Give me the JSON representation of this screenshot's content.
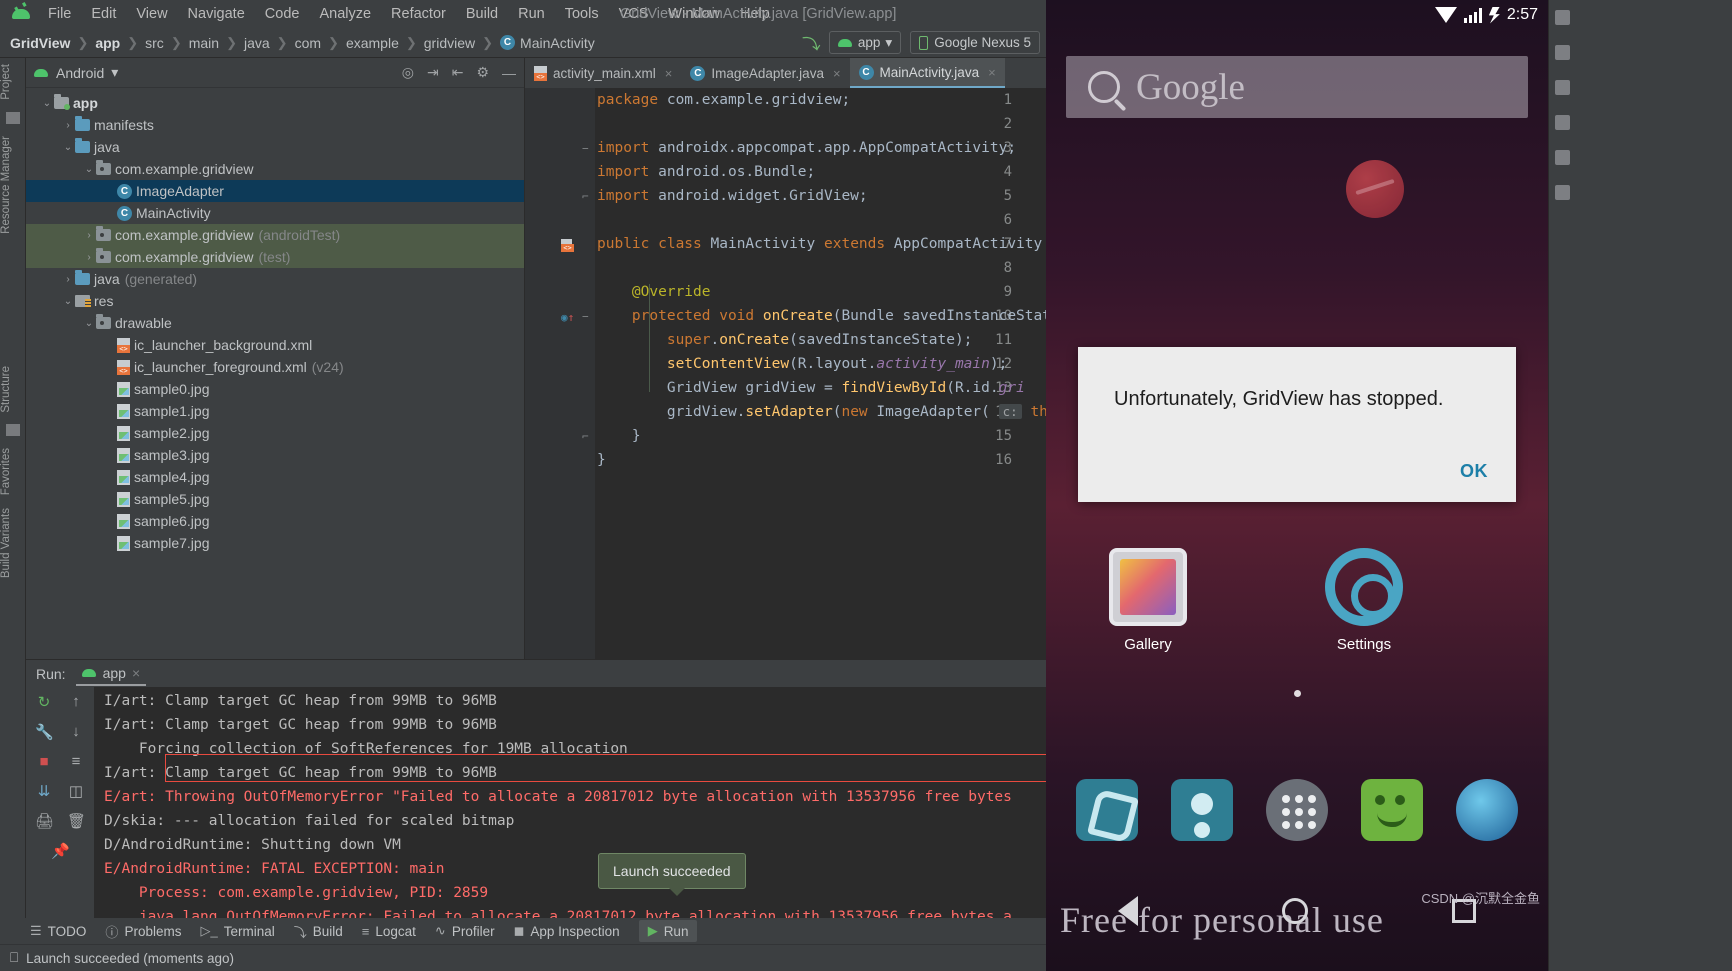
{
  "window": {
    "title": "GridView - MainActivity.java [GridView.app]"
  },
  "menu": {
    "items": [
      "File",
      "Edit",
      "View",
      "Navigate",
      "Code",
      "Analyze",
      "Refactor",
      "Build",
      "Run",
      "Tools",
      "VCS",
      "Window",
      "Help"
    ]
  },
  "breadcrumb": {
    "items": [
      "GridView",
      "app",
      "src",
      "main",
      "java",
      "com",
      "example",
      "gridview"
    ],
    "last": "MainActivity",
    "last_badge": "C"
  },
  "toolbar": {
    "hammer_icon": "build-hammer-icon",
    "run_config": "app",
    "device": "Google Nexus 5",
    "chevron": "▾"
  },
  "project": {
    "title": "Android",
    "chevron": "▾",
    "tools": [
      "locate-icon",
      "expand-all-icon",
      "collapse-all-icon",
      "settings-gear-icon",
      "hide-icon"
    ],
    "tree": [
      {
        "indent": 0,
        "arrow": "⌄",
        "icon": "folder-module",
        "label": "app",
        "dim": "",
        "bold": true,
        "state": ""
      },
      {
        "indent": 1,
        "arrow": "›",
        "icon": "folder",
        "label": "manifests",
        "dim": "",
        "bold": false,
        "state": ""
      },
      {
        "indent": 1,
        "arrow": "⌄",
        "icon": "folder",
        "label": "java",
        "dim": "",
        "bold": false,
        "state": ""
      },
      {
        "indent": 2,
        "arrow": "⌄",
        "icon": "package",
        "label": "com.example.gridview",
        "dim": "",
        "bold": false,
        "state": ""
      },
      {
        "indent": 3,
        "arrow": "",
        "icon": "class",
        "label": "ImageAdapter",
        "dim": "",
        "bold": false,
        "state": "selected"
      },
      {
        "indent": 3,
        "arrow": "",
        "icon": "class",
        "label": "MainActivity",
        "dim": "",
        "bold": false,
        "state": ""
      },
      {
        "indent": 2,
        "arrow": "›",
        "icon": "package",
        "label": "com.example.gridview",
        "dim": "(androidTest)",
        "bold": false,
        "state": "test"
      },
      {
        "indent": 2,
        "arrow": "›",
        "icon": "package",
        "label": "com.example.gridview",
        "dim": "(test)",
        "bold": false,
        "state": "test"
      },
      {
        "indent": 1,
        "arrow": "›",
        "icon": "folder-gen",
        "label": "java",
        "dim": "(generated)",
        "bold": false,
        "state": ""
      },
      {
        "indent": 1,
        "arrow": "⌄",
        "icon": "folder-res",
        "label": "res",
        "dim": "",
        "bold": false,
        "state": ""
      },
      {
        "indent": 2,
        "arrow": "⌄",
        "icon": "package",
        "label": "drawable",
        "dim": "",
        "bold": false,
        "state": ""
      },
      {
        "indent": 3,
        "arrow": "",
        "icon": "xml",
        "label": "ic_launcher_background.xml",
        "dim": "",
        "bold": false,
        "state": ""
      },
      {
        "indent": 3,
        "arrow": "",
        "icon": "xml",
        "label": "ic_launcher_foreground.xml",
        "dim": "(v24)",
        "bold": false,
        "state": ""
      },
      {
        "indent": 3,
        "arrow": "",
        "icon": "image",
        "label": "sample0.jpg",
        "dim": "",
        "bold": false,
        "state": ""
      },
      {
        "indent": 3,
        "arrow": "",
        "icon": "image",
        "label": "sample1.jpg",
        "dim": "",
        "bold": false,
        "state": ""
      },
      {
        "indent": 3,
        "arrow": "",
        "icon": "image",
        "label": "sample2.jpg",
        "dim": "",
        "bold": false,
        "state": ""
      },
      {
        "indent": 3,
        "arrow": "",
        "icon": "image",
        "label": "sample3.jpg",
        "dim": "",
        "bold": false,
        "state": ""
      },
      {
        "indent": 3,
        "arrow": "",
        "icon": "image",
        "label": "sample4.jpg",
        "dim": "",
        "bold": false,
        "state": ""
      },
      {
        "indent": 3,
        "arrow": "",
        "icon": "image",
        "label": "sample5.jpg",
        "dim": "",
        "bold": false,
        "state": ""
      },
      {
        "indent": 3,
        "arrow": "",
        "icon": "image",
        "label": "sample6.jpg",
        "dim": "",
        "bold": false,
        "state": ""
      },
      {
        "indent": 3,
        "arrow": "",
        "icon": "image",
        "label": "sample7.jpg",
        "dim": "",
        "bold": false,
        "state": ""
      }
    ]
  },
  "editor": {
    "tabs": [
      {
        "label": "activity_main.xml",
        "icon": "xml-file-icon",
        "active": false
      },
      {
        "label": "ImageAdapter.java",
        "icon": "class-icon",
        "active": false
      },
      {
        "label": "MainActivity.java",
        "icon": "class-icon",
        "active": true
      }
    ],
    "lines": [
      {
        "n": 1,
        "html": "<span class=\"k\">package</span> <span class=\"t\">com.example.gridview</span><span class=\"t\">;</span>"
      },
      {
        "n": 2,
        "html": ""
      },
      {
        "n": 3,
        "html": "<span class=\"k\">import</span> <span class=\"t\">androidx.appcompat.app.AppCompatActivity;</span>",
        "fold": "−"
      },
      {
        "n": 4,
        "html": "<span class=\"k\">import</span> <span class=\"t\">android.os.Bundle;</span>"
      },
      {
        "n": 5,
        "html": "<span class=\"k\">import</span> <span class=\"t\">android.widget.GridView;</span>",
        "fold": "⌐"
      },
      {
        "n": 6,
        "html": ""
      },
      {
        "n": 7,
        "html": "<span class=\"k\">public class</span> <span class=\"t\">MainActivity</span> <span class=\"k\">extends</span> <span class=\"t\">AppCompatActivity</span> <span class=\"t\">{</span>",
        "mark": "xml"
      },
      {
        "n": 8,
        "html": ""
      },
      {
        "n": 9,
        "html": "    <span class=\"an\">@Override</span>"
      },
      {
        "n": 10,
        "html": "    <span class=\"k\">protected void</span> <span class=\"f\">onCreate</span><span class=\"t\">(</span><span class=\"t\">Bundle savedInstanceState</span>",
        "mark": "override",
        "fold": "−"
      },
      {
        "n": 11,
        "html": "        <span class=\"k\">super</span><span class=\"t\">.</span><span class=\"f\">onCreate</span><span class=\"t\">(savedInstanceState);</span>"
      },
      {
        "n": 12,
        "html": "        <span class=\"f\">setContentView</span><span class=\"t\">(R.layout.</span><span class=\"field\">activity_main</span><span class=\"t\">);</span>"
      },
      {
        "n": 13,
        "html": "        <span class=\"t\">GridView gridView = </span><span class=\"f\">findViewById</span><span class=\"t\">(R.id.</span><span class=\"field\">gri</span>"
      },
      {
        "n": 14,
        "html": "        <span class=\"t\">gridView.</span><span class=\"f\">setAdapter</span><span class=\"t\">(</span><span class=\"k\">new</span> <span class=\"t\">ImageAdapter(</span> <span class=\"hintbox\">c:</span> <span class=\"k\">th</span>"
      },
      {
        "n": 15,
        "html": "    <span class=\"t\">}</span>",
        "fold": "⌐"
      },
      {
        "n": 16,
        "html": "<span class=\"t\">}</span>"
      }
    ]
  },
  "run_panel": {
    "label": "Run:",
    "tab": "app",
    "tab_close": "×",
    "toolbar_icons": [
      "rerun-icon",
      "scroll-up-icon",
      "wrench-icon",
      "scroll-down-icon",
      "stop-icon",
      "wrap-text-icon",
      "scroll-to-end-icon",
      "print-icon",
      "pin-icon",
      "trash-icon"
    ],
    "lines": [
      {
        "text": "I/art: Clamp target GC heap from 99MB to 96MB",
        "err": false
      },
      {
        "text": "I/art: Clamp target GC heap from 99MB to 96MB",
        "err": false
      },
      {
        "text": "    Forcing collection of SoftReferences for 19MB allocation",
        "err": false
      },
      {
        "text": "I/art: Clamp target GC heap from 99MB to 96MB",
        "err": false
      },
      {
        "text": "E/art: Throwing OutOfMemoryError \"Failed to allocate a 20817012 byte allocation with 13537956 free bytes",
        "err": true
      },
      {
        "text": "D/skia: --- allocation failed for scaled bitmap",
        "err": false
      },
      {
        "text": "D/AndroidRuntime: Shutting down VM",
        "err": false
      },
      {
        "text": "E/AndroidRuntime: FATAL EXCEPTION: main",
        "err": true
      },
      {
        "text": "    Process: com.example.gridview, PID: 2859",
        "err": true
      },
      {
        "text": "    java.lang.OutOfMemoryError: Failed to allocate a 20817012 byte allocation with 13537956 free bytes a",
        "err": true
      }
    ],
    "tooltip": "Launch succeeded"
  },
  "bottom_tools": [
    {
      "label": "TODO",
      "icon": "list-icon"
    },
    {
      "label": "Problems",
      "icon": "warning-icon"
    },
    {
      "label": "Terminal",
      "icon": "terminal-icon"
    },
    {
      "label": "Build",
      "icon": "hammer-icon"
    },
    {
      "label": "Logcat",
      "icon": "logcat-icon"
    },
    {
      "label": "Profiler",
      "icon": "profiler-icon"
    },
    {
      "label": "App Inspection",
      "icon": "inspection-icon"
    },
    {
      "label": "Run",
      "icon": "play-icon"
    }
  ],
  "status_bar": {
    "icon": "event-log-icon",
    "text": "Launch succeeded (moments ago)"
  },
  "left_rail": {
    "tabs": [
      "Project",
      "Resource Manager",
      "Structure",
      "Favorites",
      "Build Variants"
    ]
  },
  "emulator": {
    "clock": "2:57",
    "status_icons": [
      "wifi-icon",
      "signal-icon",
      "battery-charging-icon"
    ],
    "search_bar": {
      "icon": "search-icon",
      "logo": "Google"
    },
    "dialog": {
      "message": "Unfortunately, GridView has stopped.",
      "ok": "OK"
    },
    "home_apps": [
      {
        "label": "Gallery",
        "icon": "gallery-icon"
      },
      {
        "label": "Settings",
        "icon": "settings-gear-icon"
      }
    ],
    "dock": [
      "phone-icon",
      "contacts-icon",
      "all-apps-icon",
      "messaging-icon",
      "browser-icon"
    ],
    "nav": [
      "back-icon",
      "home-icon",
      "recents-icon"
    ],
    "wallpaper_text": "Free for personal use",
    "watermark": "CSDN @沉默全金鱼"
  }
}
